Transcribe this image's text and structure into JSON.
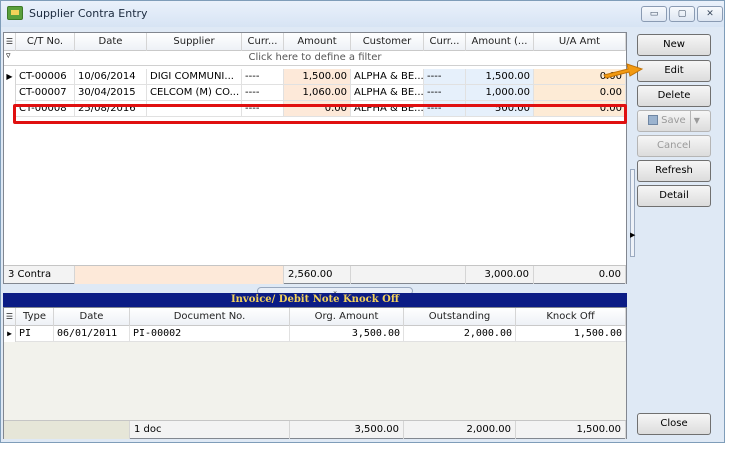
{
  "window": {
    "title": "Supplier Contra Entry",
    "minimize": "▭",
    "maximize": "▢",
    "close": "✕"
  },
  "accent": {
    "title_band_bg": "#0b1c85",
    "title_band_fg": "#f4d25a",
    "highlight": "#e01010",
    "arrow": "#f29a12"
  },
  "top_grid": {
    "columns": [
      "C/T No.",
      "Date",
      "Supplier",
      "Curr...",
      "Amount",
      "Customer",
      "Curr...",
      "Amount (...",
      "U/A Amt"
    ],
    "filter_text": "Click here to define a filter",
    "rows": [
      {
        "indicator": "▶",
        "ct_no": "CT-00006",
        "date": "10/06/2014",
        "supplier": "DIGI COMMUNI...",
        "curr": "----",
        "amount": "1,500.00",
        "customer": "ALPHA & BE...",
        "curr2": "----",
        "amount2": "1,500.00",
        "ua_amt": "0.00"
      },
      {
        "indicator": "",
        "ct_no": "CT-00007",
        "date": "30/04/2015",
        "supplier": "CELCOM (M) CO...",
        "curr": "----",
        "amount": "1,060.00",
        "customer": "ALPHA & BE...",
        "curr2": "----",
        "amount2": "1,000.00",
        "ua_amt": "0.00"
      },
      {
        "indicator": "",
        "ct_no": "CT-00008",
        "date": "25/08/2016",
        "supplier": "",
        "curr": "----",
        "amount": "0.00",
        "customer": "ALPHA & BE...",
        "curr2": "----",
        "amount2": "500.00",
        "ua_amt": "0.00"
      }
    ],
    "footer": {
      "count": "3 Contra",
      "amount_total": "2,560.00",
      "amount2_total": "3,000.00",
      "ua_total": "0.00"
    }
  },
  "band_title": "Invoice/ Debit Note Knock Off",
  "bottom_grid": {
    "columns": [
      "Type",
      "Date",
      "Document No.",
      "Org. Amount",
      "Outstanding",
      "Knock Off"
    ],
    "rows": [
      {
        "indicator": "▶",
        "type": "PI",
        "date": "06/01/2011",
        "doc_no": "PI-00002",
        "org_amount": "3,500.00",
        "outstanding": "2,000.00",
        "knock_off": "1,500.00"
      }
    ],
    "footer": {
      "count": "1 doc",
      "org_total": "3,500.00",
      "outstanding_total": "2,000.00",
      "knock_total": "1,500.00"
    }
  },
  "buttons": {
    "new": "New",
    "edit": "Edit",
    "delete": "Delete",
    "save": "Save",
    "cancel": "Cancel",
    "refresh": "Refresh",
    "detail": "Detail",
    "close": "Close"
  }
}
